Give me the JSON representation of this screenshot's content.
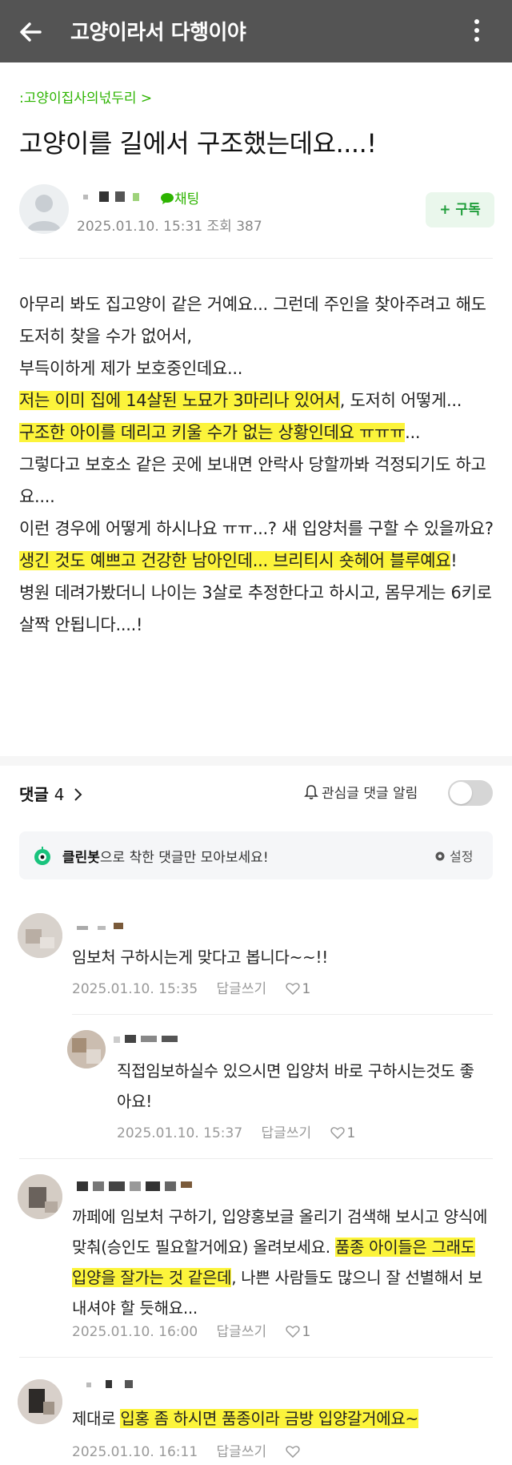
{
  "header": {
    "title": "고양이라서 다행이야"
  },
  "post": {
    "board": ":고양이집사의넋두리 >",
    "title": "고양이를 길에서 구조했는데요....!",
    "chat_label": "채팅",
    "meta": "2025.01.10. 15:31  조회 387",
    "subscribe_label": "+ 구독",
    "body": {
      "p1": "아무리 봐도 집고양이 같은 거예요... 그런데 주인을 찾아주려고 해도 도저히 찾을 수가 없어서,",
      "p2": "부득이하게 제가 보호중인데요...",
      "p3_hl": "저는 이미 집에 14살된 노묘가 3마리나 있어서",
      "p3_rest": ", 도저히 어떻게...",
      "p4_hl": "구조한 아이를 데리고 키울 수가 없는 상황인데요 ㅠㅠㅠ",
      "p4_rest": "...",
      "p5": "그렇다고 보호소 같은 곳에 보내면 안락사 당할까봐 걱정되기도 하고요....",
      "p6": "이런 경우에 어떻게 하시나요 ㅠㅠ...? 새 입양처를 구할 수 있을까요?",
      "p7_hl": "생긴 것도 예쁘고 건강한 남아인데... 브리티시 숏헤어 블루예요",
      "p7_rest": "!",
      "p8": "병원 데려가봤더니 나이는 3살로 추정한다고 하시고, 몸무게는 6키로 살짝 안됩니다....!"
    }
  },
  "comments_section": {
    "label": "댓글",
    "count": "4",
    "notify_label": "관심글 댓글 알림",
    "cleanbot_name": "클린봇",
    "cleanbot_text": "으로 착한 댓글만 모아보세요!",
    "setting_label": "설정"
  },
  "comments": [
    {
      "text": "임보처 구하시는게 맞다고 봅니다~~!!",
      "date": "2025.01.10. 15:35",
      "reply": "답글쓰기",
      "likes": "1"
    },
    {
      "text": "직접임보하실수 있으시면 입양처 바로 구하시는것도 좋아요!",
      "date": "2025.01.10. 15:37",
      "reply": "답글쓰기",
      "likes": "1"
    },
    {
      "text_1": "까페에 임보처 구하기, 입양홍보글 올리기 검색해 보시고 양식에 맞춰(승인도 필요할거에요) 올려보세요.",
      "text_2_hl": "품종 아이들은 그래도 입양을 잘가는 것 같은데",
      "text_2_rest": ", 나쁜 사람들도 많으니 잘 선별해서 보내셔야 할 듯해요...",
      "date": "2025.01.10. 16:00",
      "reply": "답글쓰기",
      "likes": "1"
    },
    {
      "text_pre": "제대로 ",
      "text_hl": "입홍 좀 하시면 품종이라 금방 입양갈거에요~",
      "date": "2025.01.10. 16:11",
      "reply": "답글쓰기",
      "likes": ""
    }
  ],
  "colors": {
    "appbar": "#545454",
    "accent_green": "#2db400",
    "highlight": "#fcf43b"
  },
  "icons": [
    "back-arrow-icon",
    "more-vert-icon",
    "chat-bubble-icon",
    "chevron-right-icon",
    "bell-icon",
    "cleanbot-icon",
    "gear-icon",
    "heart-icon"
  ]
}
